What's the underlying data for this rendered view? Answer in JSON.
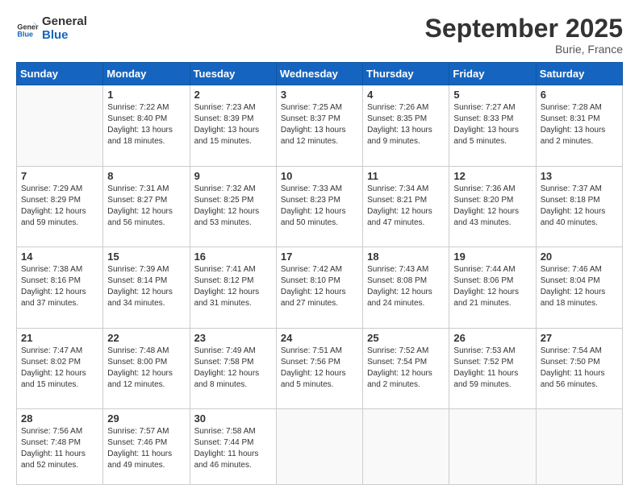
{
  "header": {
    "logo_text_general": "General",
    "logo_text_blue": "Blue",
    "month": "September 2025",
    "location": "Burie, France"
  },
  "weekdays": [
    "Sunday",
    "Monday",
    "Tuesday",
    "Wednesday",
    "Thursday",
    "Friday",
    "Saturday"
  ],
  "rows": [
    [
      {
        "day": "",
        "empty": true
      },
      {
        "day": "1",
        "sunrise": "7:22 AM",
        "sunset": "8:40 PM",
        "daylight": "13 hours and 18 minutes."
      },
      {
        "day": "2",
        "sunrise": "7:23 AM",
        "sunset": "8:39 PM",
        "daylight": "13 hours and 15 minutes."
      },
      {
        "day": "3",
        "sunrise": "7:25 AM",
        "sunset": "8:37 PM",
        "daylight": "13 hours and 12 minutes."
      },
      {
        "day": "4",
        "sunrise": "7:26 AM",
        "sunset": "8:35 PM",
        "daylight": "13 hours and 9 minutes."
      },
      {
        "day": "5",
        "sunrise": "7:27 AM",
        "sunset": "8:33 PM",
        "daylight": "13 hours and 5 minutes."
      },
      {
        "day": "6",
        "sunrise": "7:28 AM",
        "sunset": "8:31 PM",
        "daylight": "13 hours and 2 minutes."
      }
    ],
    [
      {
        "day": "7",
        "sunrise": "7:29 AM",
        "sunset": "8:29 PM",
        "daylight": "12 hours and 59 minutes."
      },
      {
        "day": "8",
        "sunrise": "7:31 AM",
        "sunset": "8:27 PM",
        "daylight": "12 hours and 56 minutes."
      },
      {
        "day": "9",
        "sunrise": "7:32 AM",
        "sunset": "8:25 PM",
        "daylight": "12 hours and 53 minutes."
      },
      {
        "day": "10",
        "sunrise": "7:33 AM",
        "sunset": "8:23 PM",
        "daylight": "12 hours and 50 minutes."
      },
      {
        "day": "11",
        "sunrise": "7:34 AM",
        "sunset": "8:21 PM",
        "daylight": "12 hours and 47 minutes."
      },
      {
        "day": "12",
        "sunrise": "7:36 AM",
        "sunset": "8:20 PM",
        "daylight": "12 hours and 43 minutes."
      },
      {
        "day": "13",
        "sunrise": "7:37 AM",
        "sunset": "8:18 PM",
        "daylight": "12 hours and 40 minutes."
      }
    ],
    [
      {
        "day": "14",
        "sunrise": "7:38 AM",
        "sunset": "8:16 PM",
        "daylight": "12 hours and 37 minutes."
      },
      {
        "day": "15",
        "sunrise": "7:39 AM",
        "sunset": "8:14 PM",
        "daylight": "12 hours and 34 minutes."
      },
      {
        "day": "16",
        "sunrise": "7:41 AM",
        "sunset": "8:12 PM",
        "daylight": "12 hours and 31 minutes."
      },
      {
        "day": "17",
        "sunrise": "7:42 AM",
        "sunset": "8:10 PM",
        "daylight": "12 hours and 27 minutes."
      },
      {
        "day": "18",
        "sunrise": "7:43 AM",
        "sunset": "8:08 PM",
        "daylight": "12 hours and 24 minutes."
      },
      {
        "day": "19",
        "sunrise": "7:44 AM",
        "sunset": "8:06 PM",
        "daylight": "12 hours and 21 minutes."
      },
      {
        "day": "20",
        "sunrise": "7:46 AM",
        "sunset": "8:04 PM",
        "daylight": "12 hours and 18 minutes."
      }
    ],
    [
      {
        "day": "21",
        "sunrise": "7:47 AM",
        "sunset": "8:02 PM",
        "daylight": "12 hours and 15 minutes."
      },
      {
        "day": "22",
        "sunrise": "7:48 AM",
        "sunset": "8:00 PM",
        "daylight": "12 hours and 12 minutes."
      },
      {
        "day": "23",
        "sunrise": "7:49 AM",
        "sunset": "7:58 PM",
        "daylight": "12 hours and 8 minutes."
      },
      {
        "day": "24",
        "sunrise": "7:51 AM",
        "sunset": "7:56 PM",
        "daylight": "12 hours and 5 minutes."
      },
      {
        "day": "25",
        "sunrise": "7:52 AM",
        "sunset": "7:54 PM",
        "daylight": "12 hours and 2 minutes."
      },
      {
        "day": "26",
        "sunrise": "7:53 AM",
        "sunset": "7:52 PM",
        "daylight": "11 hours and 59 minutes."
      },
      {
        "day": "27",
        "sunrise": "7:54 AM",
        "sunset": "7:50 PM",
        "daylight": "11 hours and 56 minutes."
      }
    ],
    [
      {
        "day": "28",
        "sunrise": "7:56 AM",
        "sunset": "7:48 PM",
        "daylight": "11 hours and 52 minutes."
      },
      {
        "day": "29",
        "sunrise": "7:57 AM",
        "sunset": "7:46 PM",
        "daylight": "11 hours and 49 minutes."
      },
      {
        "day": "30",
        "sunrise": "7:58 AM",
        "sunset": "7:44 PM",
        "daylight": "11 hours and 46 minutes."
      },
      {
        "day": "",
        "empty": true
      },
      {
        "day": "",
        "empty": true
      },
      {
        "day": "",
        "empty": true
      },
      {
        "day": "",
        "empty": true
      }
    ]
  ],
  "labels": {
    "sunrise_prefix": "Sunrise: ",
    "sunset_prefix": "Sunset: ",
    "daylight_prefix": "Daylight: "
  }
}
